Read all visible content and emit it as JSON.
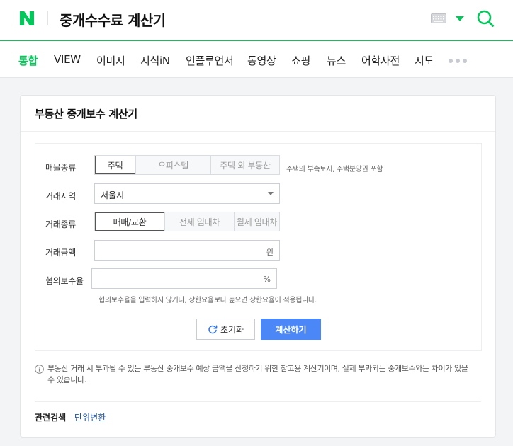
{
  "header": {
    "title": "중개수수료 계산기",
    "logo_letter": "N",
    "brand_color": "#03c75a"
  },
  "nav": {
    "items": [
      {
        "label": "통합",
        "active": true
      },
      {
        "label": "VIEW"
      },
      {
        "label": "이미지"
      },
      {
        "label": "지식iN"
      },
      {
        "label": "인플루언서"
      },
      {
        "label": "동영상"
      },
      {
        "label": "쇼핑"
      },
      {
        "label": "뉴스"
      },
      {
        "label": "어학사전"
      },
      {
        "label": "지도"
      }
    ]
  },
  "calculator": {
    "title": "부동산 중개보수 계산기",
    "property_type": {
      "label": "매물종류",
      "options": [
        "주택",
        "오피스텔",
        "주택 외 부동산"
      ],
      "selected": "주택",
      "helper": "주택의 부속토지, 주택분양권 포함"
    },
    "region": {
      "label": "거래지역",
      "value": "서울시"
    },
    "deal_type": {
      "label": "거래종류",
      "options": [
        "매매/교환",
        "전세 임대차",
        "월세 임대차"
      ],
      "selected": "매매/교환"
    },
    "amount": {
      "label": "거래금액",
      "value": "",
      "unit": "원"
    },
    "rate": {
      "label": "협의보수율",
      "value": "",
      "unit": "%",
      "helper": "협의보수율을 입력하지 않거나, 상한요율보다 높으면 상한요율이 적용됩니다."
    },
    "reset_label": "초기화",
    "calc_label": "계산하기",
    "calc_color": "#4c87f7",
    "notice": "부동산 거래 시 부과될 수 있는 부동산 중개보수 예상 금액을 산정하기 위한 참고용 계산기이며, 실제 부과되는 중개보수와는 차이가 있을 수 있습니다."
  },
  "related": {
    "label": "관련검색",
    "links": [
      "단위변환"
    ]
  }
}
